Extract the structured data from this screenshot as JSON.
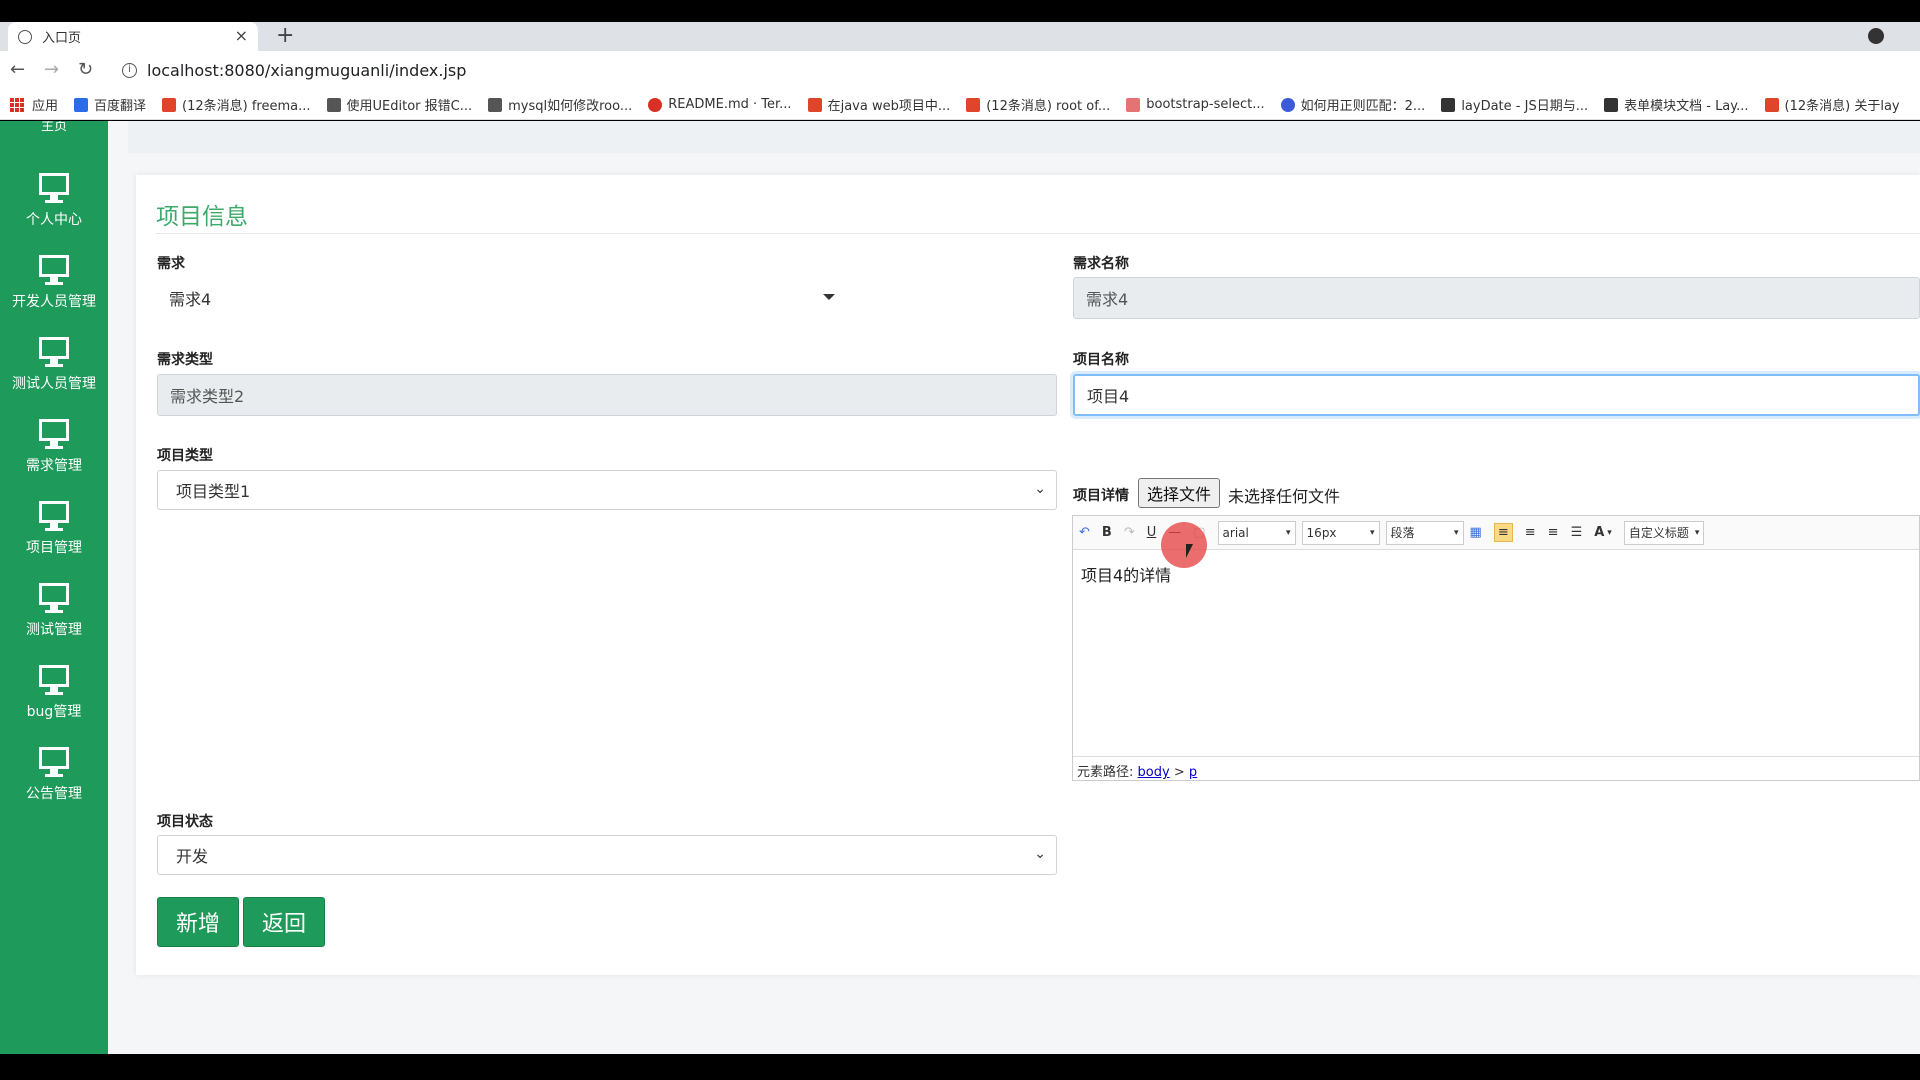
{
  "browser": {
    "tab_title": "入口页",
    "url": "localhost:8080/xiangmuguanli/index.jsp",
    "bookmarks": [
      "应用",
      "百度翻译",
      "(12条消息) freema...",
      "使用UEditor 报错C...",
      "mysql如何修改roo...",
      "README.md · Ter...",
      "在java web项目中...",
      "(12条消息) root of...",
      "bootstrap-select...",
      "如何用正则匹配：2...",
      "layDate - JS日期与...",
      "表单模块文档 - Lay...",
      "(12条消息) 关于lay"
    ]
  },
  "sidebar": {
    "top_label": "主页",
    "items": [
      {
        "label": "个人中心"
      },
      {
        "label": "开发人员管理"
      },
      {
        "label": "测试人员管理"
      },
      {
        "label": "需求管理"
      },
      {
        "label": "项目管理"
      },
      {
        "label": "测试管理"
      },
      {
        "label": "bug管理"
      },
      {
        "label": "公告管理"
      }
    ]
  },
  "form": {
    "title": "项目信息",
    "requirement": {
      "label": "需求",
      "value": "需求4"
    },
    "requirement_name": {
      "label": "需求名称",
      "value": "需求4"
    },
    "requirement_type": {
      "label": "需求类型",
      "value": "需求类型2"
    },
    "project_name": {
      "label": "项目名称",
      "value": "项目4"
    },
    "project_type": {
      "label": "项目类型",
      "value": "项目类型1"
    },
    "project_detail": {
      "label": "项目详情",
      "file_button": "选择文件",
      "file_status": "未选择任何文件",
      "toolbar": {
        "font_family": "arial",
        "font_size": "16px",
        "paragraph": "段落",
        "font_color": "A",
        "custom_title": "自定义标题"
      },
      "content": "项目4的详情",
      "path_label": "元素路径:",
      "path_body": "body",
      "path_sep": ">",
      "path_p": "p"
    },
    "project_status": {
      "label": "项目状态",
      "value": "开发"
    },
    "buttons": {
      "add": "新增",
      "back": "返回"
    }
  },
  "colors": {
    "sidebar": "#1e9a5a",
    "title": "#3fa96c",
    "button": "#1e9a5a"
  }
}
